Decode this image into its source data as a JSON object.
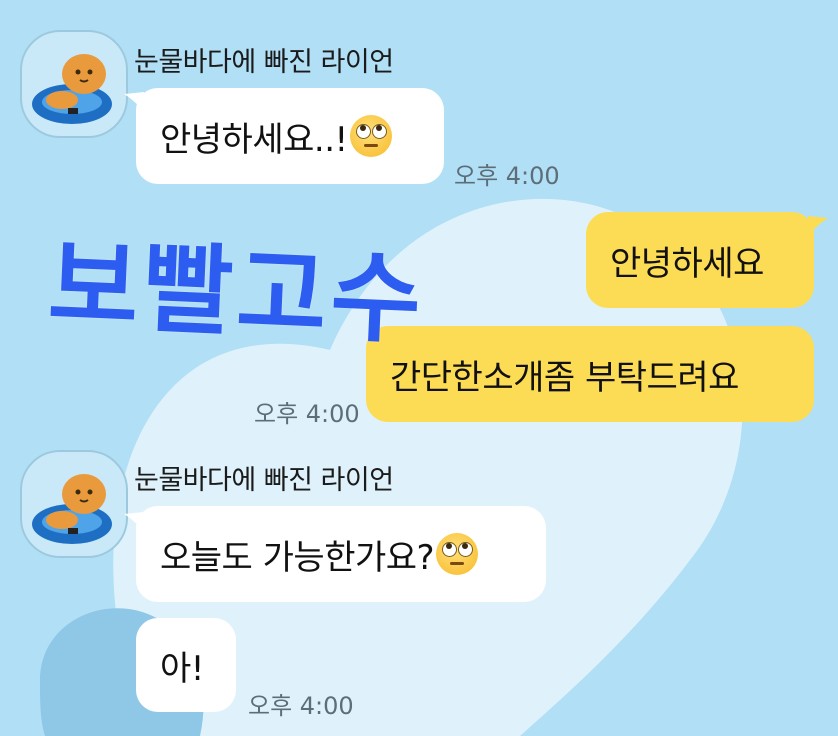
{
  "chat": {
    "sender_name": "눈물바다에 빠진 라이언",
    "messages": [
      {
        "text": "안녕하세요..!",
        "emoji": "rolling-eyes-emoji",
        "time": "오후 4:00"
      },
      {
        "text": "안녕하세요"
      },
      {
        "text": "간단한소개좀 부탁드려요",
        "time": "오후 4:00"
      },
      {
        "text": "오늘도 가능한가요?",
        "emoji": "rolling-eyes-emoji"
      },
      {
        "text": "아!",
        "time": "오후 4:00"
      }
    ]
  },
  "watermark": {
    "text": "보빨고수"
  },
  "colors": {
    "background": "#b1dff5",
    "heart": "#dff2fb",
    "my_bubble": "#fddc55",
    "their_bubble": "#ffffff",
    "watermark": "#2d5cf0"
  }
}
